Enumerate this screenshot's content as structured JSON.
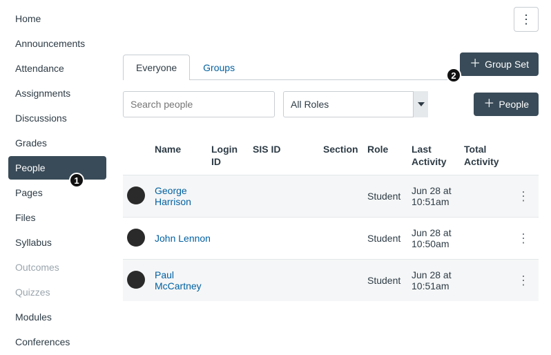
{
  "badges": {
    "nav_people": "1",
    "group_set": "2"
  },
  "sidebar": {
    "items": [
      {
        "label": "Home",
        "active": false,
        "disabled": false
      },
      {
        "label": "Announcements",
        "active": false,
        "disabled": false
      },
      {
        "label": "Attendance",
        "active": false,
        "disabled": false
      },
      {
        "label": "Assignments",
        "active": false,
        "disabled": false
      },
      {
        "label": "Discussions",
        "active": false,
        "disabled": false
      },
      {
        "label": "Grades",
        "active": false,
        "disabled": false
      },
      {
        "label": "People",
        "active": true,
        "disabled": false
      },
      {
        "label": "Pages",
        "active": false,
        "disabled": false
      },
      {
        "label": "Files",
        "active": false,
        "disabled": false
      },
      {
        "label": "Syllabus",
        "active": false,
        "disabled": false
      },
      {
        "label": "Outcomes",
        "active": false,
        "disabled": true
      },
      {
        "label": "Quizzes",
        "active": false,
        "disabled": true
      },
      {
        "label": "Modules",
        "active": false,
        "disabled": false
      },
      {
        "label": "Conferences",
        "active": false,
        "disabled": false
      }
    ]
  },
  "tabs": {
    "everyone": "Everyone",
    "groups": "Groups"
  },
  "buttons": {
    "group_set": "Group Set",
    "add_people": "People"
  },
  "filters": {
    "search_placeholder": "Search people",
    "role_selected": "All Roles"
  },
  "table": {
    "headers": {
      "name": "Name",
      "login_id": "Login ID",
      "sis_id": "SIS ID",
      "section": "Section",
      "role": "Role",
      "last_activity": "Last Activity",
      "total_activity": "Total Activity"
    },
    "rows": [
      {
        "name": "George Harrison",
        "login_id": "",
        "sis_id": "",
        "section": "",
        "role": "Student",
        "last_activity": "Jun 28 at 10:51am",
        "total_activity": ""
      },
      {
        "name": "John Lennon",
        "login_id": "",
        "sis_id": "",
        "section": "",
        "role": "Student",
        "last_activity": "Jun 28 at 10:50am",
        "total_activity": ""
      },
      {
        "name": "Paul McCartney",
        "login_id": "",
        "sis_id": "",
        "section": "",
        "role": "Student",
        "last_activity": "Jun 28 at 10:51am",
        "total_activity": ""
      }
    ]
  }
}
